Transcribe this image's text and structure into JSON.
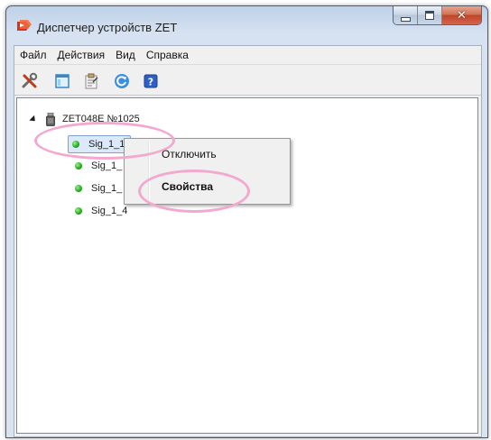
{
  "window": {
    "title": "Диспетчер устройств ZET",
    "close_glyph": "✕"
  },
  "menu": [
    "Файл",
    "Действия",
    "Вид",
    "Справка"
  ],
  "toolbar": {
    "buttons": [
      "wrench-icon",
      "window-icon",
      "properties-icon",
      "refresh-icon",
      "help-icon"
    ],
    "help_glyph": "?"
  },
  "tree": {
    "root": {
      "label": "ZET048E №1025",
      "expanded": true
    },
    "nodes": [
      {
        "label": "Sig_1_1",
        "selected": true
      },
      {
        "label": "Sig_1_"
      },
      {
        "label": "Sig_1_"
      },
      {
        "label": "Sig_1_4"
      }
    ]
  },
  "context_menu": {
    "items": [
      {
        "label": "Отключить"
      },
      {
        "label": "Свойства",
        "default": true
      }
    ]
  },
  "colors": {
    "status_ok": "#1fa81b",
    "selection": "#dbe9fb",
    "highlight": "#f3a8cf"
  }
}
